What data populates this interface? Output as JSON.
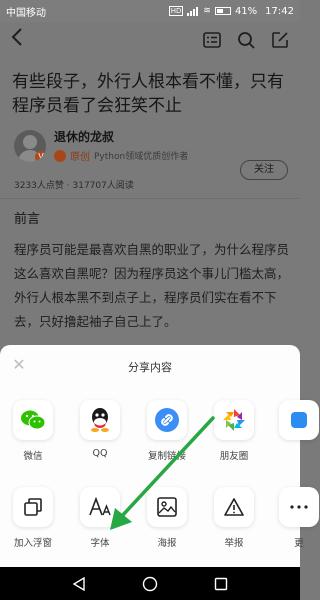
{
  "status_bar": {
    "carrier": "中国移动",
    "network_badge": "HD",
    "battery": "41%",
    "time": "17:42"
  },
  "article": {
    "toolbar_icons": [
      "back-icon",
      "list-icon",
      "search-icon",
      "edit-icon"
    ],
    "title": "有些段子，外行人根本看不懂，只有程序员看了会狂笑不止",
    "author": {
      "name": "退休的龙叔",
      "original_label": "原创",
      "description": "Python领域优质创作者",
      "follow_label": "关注"
    },
    "stats": "3233人点赞 · 317707人阅读",
    "section_heading": "前言",
    "paragraph": "程序员可能是最喜欢自黑的职业了，为什么程序员这么喜欢自黑呢？因为程序员这个事儿门槛太高，外行人根本黑不到点子上，程序员们实在看不下去，只好撸起袖子自己上了。"
  },
  "share_sheet": {
    "title": "分享内容",
    "row1": [
      {
        "label": "微信",
        "icon": "wechat-icon",
        "color": "#2dc100"
      },
      {
        "label": "QQ",
        "icon": "qq-icon",
        "color": "#1a1a1a"
      },
      {
        "label": "复制链接",
        "icon": "link-icon",
        "color": "#3a8ef6"
      },
      {
        "label": "朋友圈",
        "icon": "moments-icon",
        "color": "#f5a623"
      }
    ],
    "row2": [
      {
        "label": "加入浮窗",
        "icon": "floating-window-icon"
      },
      {
        "label": "字体",
        "icon": "font-icon"
      },
      {
        "label": "海报",
        "icon": "poster-icon"
      },
      {
        "label": "举报",
        "icon": "report-icon"
      },
      {
        "label": "更",
        "icon": "more-icon"
      }
    ]
  },
  "annotation": {
    "arrow_color": "#27a844"
  }
}
